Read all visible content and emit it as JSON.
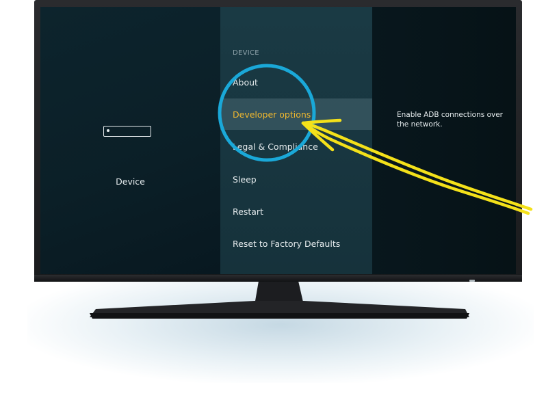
{
  "sidebar": {
    "icon": "device-icon",
    "label": "Device"
  },
  "menu": {
    "section_title": "DEVICE",
    "items": [
      {
        "label": "About",
        "selected": false
      },
      {
        "label": "Developer options",
        "selected": true
      },
      {
        "label": "Legal & Compliance",
        "selected": false
      },
      {
        "label": "Sleep",
        "selected": false
      },
      {
        "label": "Restart",
        "selected": false
      },
      {
        "label": "Reset to Factory Defaults",
        "selected": false
      }
    ]
  },
  "detail": {
    "description": "Enable ADB connections over the network."
  },
  "annotation": {
    "circle_color": "#1aa8d8",
    "arrow_color": "#f4e11a",
    "highlight_color": "#f2b92e"
  }
}
